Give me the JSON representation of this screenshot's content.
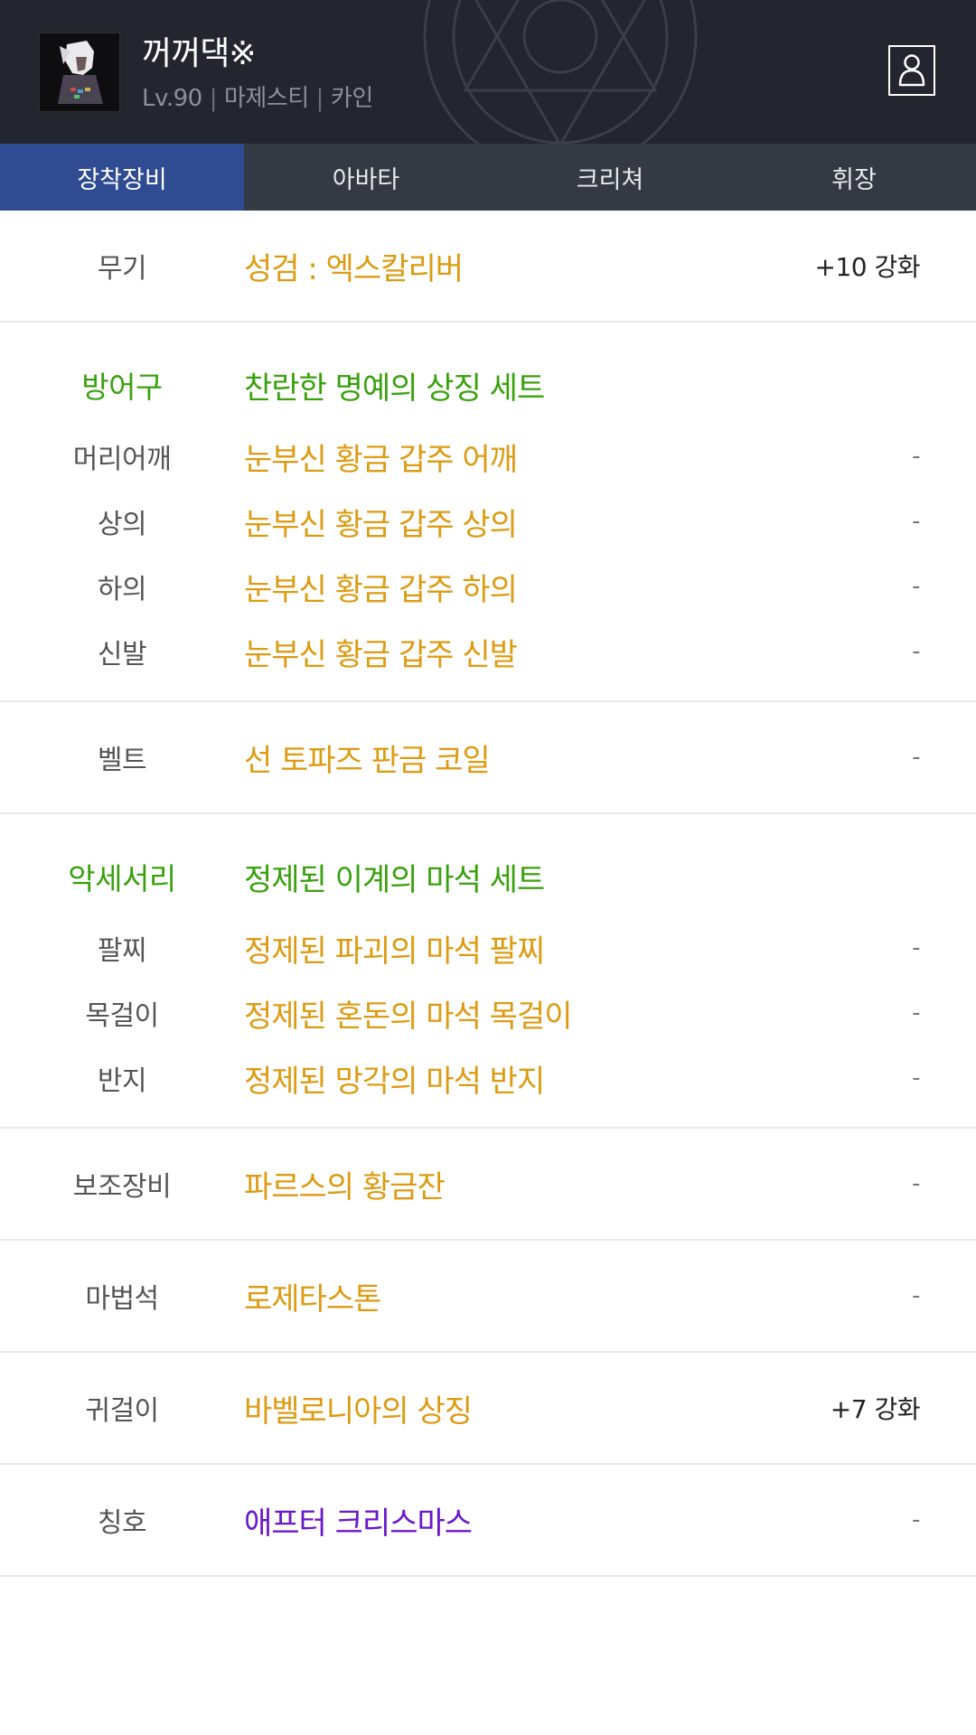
{
  "header": {
    "character_name": "꺼꺼댁※",
    "level": "Lv.90",
    "job": "마제스티",
    "server": "카인"
  },
  "tabs": [
    {
      "label": "장착장비",
      "active": true
    },
    {
      "label": "아바타",
      "active": false
    },
    {
      "label": "크리쳐",
      "active": false
    },
    {
      "label": "휘장",
      "active": false
    }
  ],
  "equipment": {
    "weapon": {
      "category": "무기",
      "item": "성검 : 엑스칼리버",
      "enhance": "+10 강화"
    },
    "armor": {
      "category": "방어구",
      "set_name": "찬란한 명예의 상징 세트",
      "items": [
        {
          "category": "머리어깨",
          "item": "눈부신 황금 갑주 어깨",
          "enhance": "-"
        },
        {
          "category": "상의",
          "item": "눈부신 황금 갑주 상의",
          "enhance": "-"
        },
        {
          "category": "하의",
          "item": "눈부신 황금 갑주 하의",
          "enhance": "-"
        },
        {
          "category": "신발",
          "item": "눈부신 황금 갑주 신발",
          "enhance": "-"
        }
      ]
    },
    "belt": {
      "category": "벨트",
      "item": "선 토파즈 판금 코일",
      "enhance": "-"
    },
    "accessory": {
      "category": "악세서리",
      "set_name": "정제된 이계의 마석 세트",
      "items": [
        {
          "category": "팔찌",
          "item": "정제된 파괴의 마석 팔찌",
          "enhance": "-"
        },
        {
          "category": "목걸이",
          "item": "정제된 혼돈의 마석 목걸이",
          "enhance": "-"
        },
        {
          "category": "반지",
          "item": "정제된 망각의 마석 반지",
          "enhance": "-"
        }
      ]
    },
    "sub": {
      "category": "보조장비",
      "item": "파르스의 황금잔",
      "enhance": "-"
    },
    "magic_stone": {
      "category": "마법석",
      "item": "로제타스톤",
      "enhance": "-"
    },
    "earring": {
      "category": "귀걸이",
      "item": "바벨로니아의 상징",
      "enhance": "+7 강화"
    },
    "title": {
      "category": "칭호",
      "item": "애프터 크리스마스",
      "enhance": "-"
    }
  },
  "colors": {
    "header_bg": "#23262f",
    "tab_bg": "#343944",
    "tab_active": "#2f4c93",
    "item_unique": "#dd9b12",
    "set_green": "#3aa10e",
    "item_purple": "#6b17cc"
  }
}
